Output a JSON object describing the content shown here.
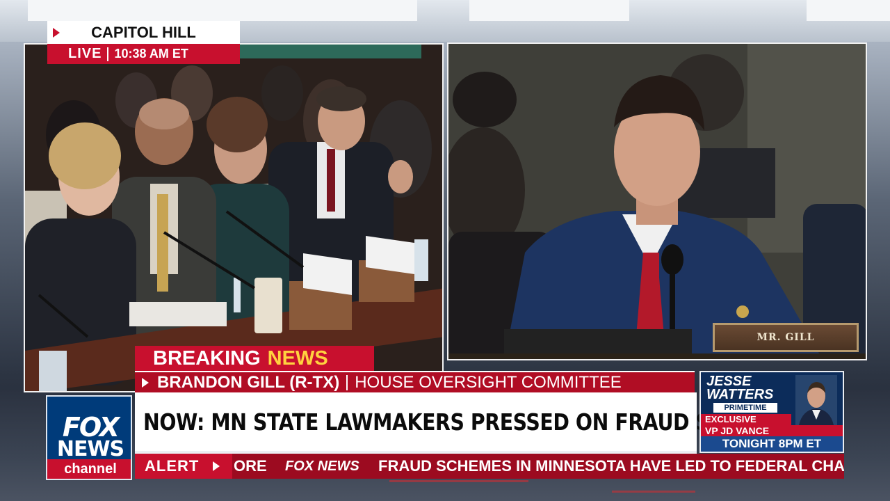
{
  "location": {
    "label": "CAPITOL HILL",
    "live": "LIVE",
    "time": "10:38 AM ET"
  },
  "lower_third": {
    "breaking_word1": "BREAKING",
    "breaking_word2": "NEWS",
    "speaker": "BRANDON GILL (R-TX)",
    "committee": "HOUSE OVERSIGHT COMMITTEE",
    "headline": "NOW: MN STATE LAWMAKERS PRESSED ON FRAUD SCANDAL"
  },
  "logo": {
    "line1": "FOX",
    "line2": "NEWS",
    "line3": "channel"
  },
  "promo": {
    "show": "JESSE WATTERS",
    "sub": "PRIMETIME",
    "exclusive": "EXCLUSIVE",
    "guest": "VP JD VANCE",
    "time": "TONIGHT 8PM ET"
  },
  "ticker": {
    "label": "ALERT",
    "prev": "ORE",
    "brand": "FOX NEWS",
    "story": "FRAUD SCHEMES IN MINNESOTA HAVE LED TO FEDERAL CHAI"
  },
  "nameplate": "MR. GILL",
  "colors": {
    "fox_red": "#c8102e",
    "fox_blue": "#003b7a",
    "breaking_yellow": "#ffd23f"
  }
}
